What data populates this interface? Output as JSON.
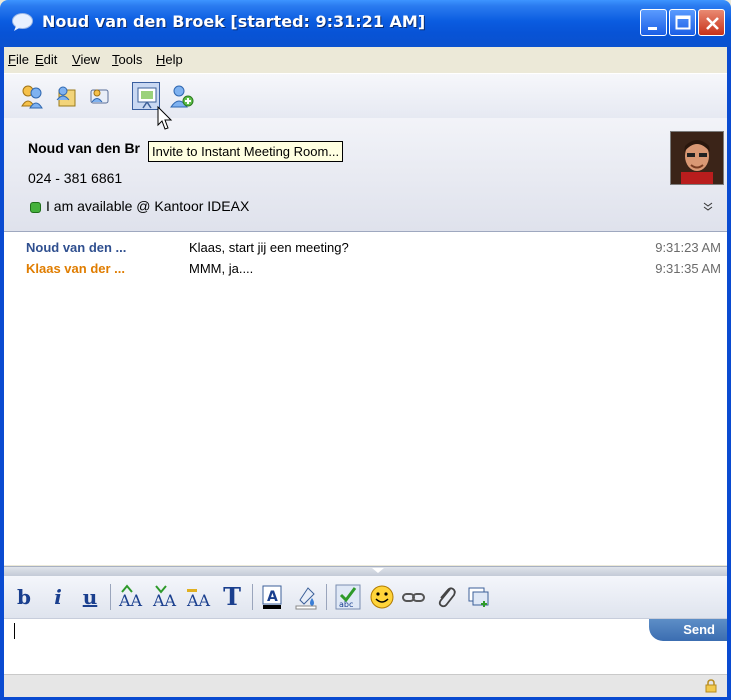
{
  "window": {
    "title": "Noud van den Broek [started: 9:31:21 AM]",
    "colors": {
      "titlebar": "#0a52cf",
      "name_self": "#2f4f8f",
      "name_other": "#e07d00"
    }
  },
  "menu": [
    "File",
    "Edit",
    "View",
    "Tools",
    "Help"
  ],
  "toolbar": {
    "buttons": [
      "contacts-icon",
      "file-transfer-icon",
      "chat-icon",
      "meeting-room-icon",
      "add-person-icon"
    ],
    "tooltip": "Invite to Instant Meeting Room..."
  },
  "contact": {
    "name": "Noud van den Br",
    "phone": "024 - 381 6861",
    "status": "I am available @ Kantoor IDEAX"
  },
  "transcript": [
    {
      "sender": "Noud van den ...",
      "message": "Klaas, start jij een meeting?",
      "time": "9:31:23 AM"
    },
    {
      "sender": "Klaas van der ...",
      "message": "MMM, ja....",
      "time": "9:31:35 AM"
    }
  ],
  "format": {
    "bold": "b",
    "italic": "i",
    "underline": "u",
    "font": "T"
  },
  "input": {
    "send_label": "Send"
  }
}
